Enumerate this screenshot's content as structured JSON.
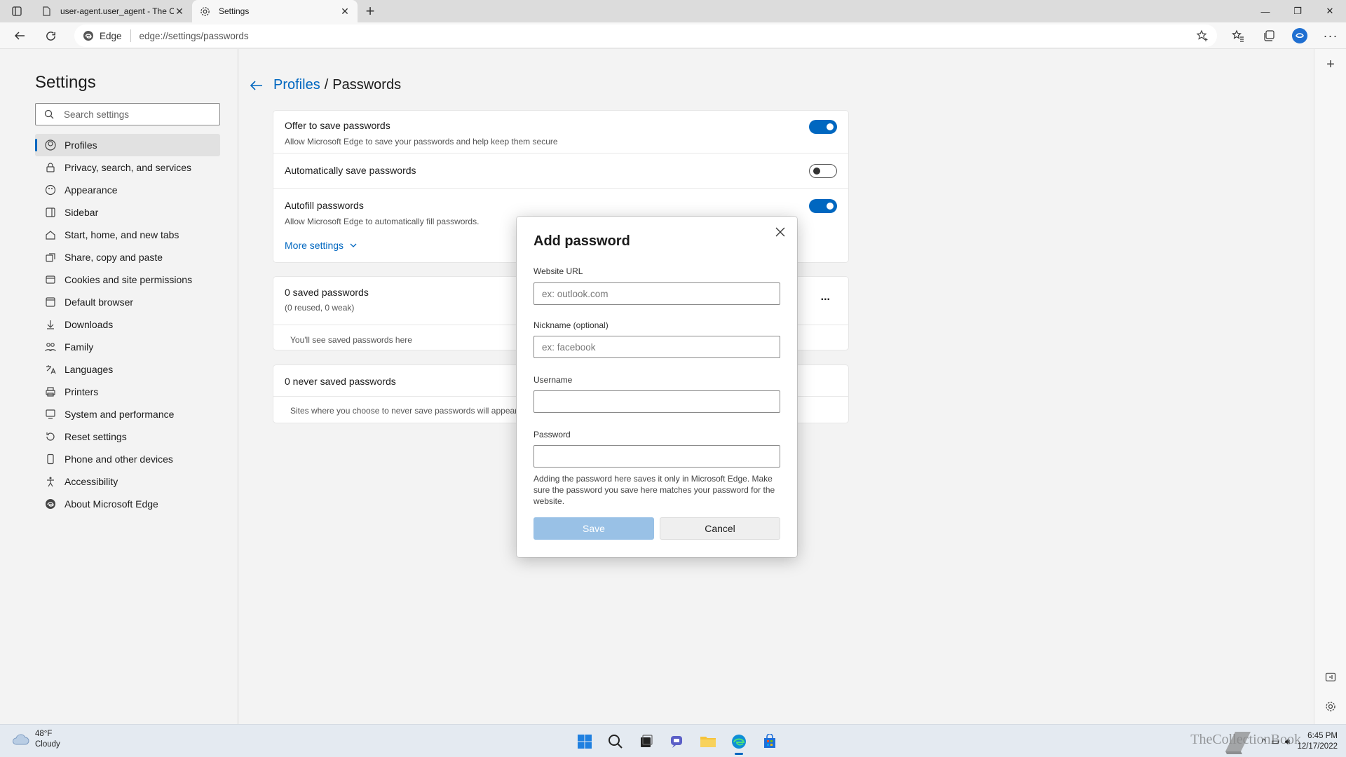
{
  "browser": {
    "tabs": [
      {
        "title": "user-agent.user_agent - The Coll",
        "active": false
      },
      {
        "title": "Settings",
        "active": true
      }
    ],
    "address": {
      "chip": "Edge",
      "url": "edge://settings/passwords"
    }
  },
  "sidebar": {
    "title": "Settings",
    "search_placeholder": "Search settings",
    "items": [
      {
        "label": "Profiles",
        "icon": "profile-icon",
        "selected": true
      },
      {
        "label": "Privacy, search, and services",
        "icon": "lock-icon"
      },
      {
        "label": "Appearance",
        "icon": "appearance-icon"
      },
      {
        "label": "Sidebar",
        "icon": "sidebar-icon"
      },
      {
        "label": "Start, home, and new tabs",
        "icon": "home-icon"
      },
      {
        "label": "Share, copy and paste",
        "icon": "share-icon"
      },
      {
        "label": "Cookies and site permissions",
        "icon": "cookie-icon"
      },
      {
        "label": "Default browser",
        "icon": "browser-icon"
      },
      {
        "label": "Downloads",
        "icon": "download-icon"
      },
      {
        "label": "Family",
        "icon": "family-icon"
      },
      {
        "label": "Languages",
        "icon": "language-icon"
      },
      {
        "label": "Printers",
        "icon": "printer-icon"
      },
      {
        "label": "System and performance",
        "icon": "system-icon"
      },
      {
        "label": "Reset settings",
        "icon": "reset-icon"
      },
      {
        "label": "Phone and other devices",
        "icon": "phone-icon"
      },
      {
        "label": "Accessibility",
        "icon": "accessibility-icon"
      },
      {
        "label": "About Microsoft Edge",
        "icon": "edge-icon"
      }
    ]
  },
  "main": {
    "breadcrumb": {
      "parent": "Profiles",
      "separator": "/",
      "current": "Passwords"
    },
    "settings": {
      "offer_title": "Offer to save passwords",
      "offer_sub": "Allow Microsoft Edge to save your passwords and help keep them secure",
      "offer_on": true,
      "auto_title": "Automatically save passwords",
      "auto_on": false,
      "autofill_title": "Autofill passwords",
      "autofill_sub": "Allow Microsoft Edge to automatically fill passwords.",
      "autofill_on": true,
      "more": "More settings"
    },
    "saved": {
      "title": "0 saved passwords",
      "sub": "(0 reused, 0 weak)",
      "empty": "You'll see saved passwords here",
      "menu": "..."
    },
    "never": {
      "title": "0 never saved passwords",
      "empty": "Sites where you choose to never save passwords will appear here"
    }
  },
  "dialog": {
    "title": "Add password",
    "url_label": "Website URL",
    "url_placeholder": "ex: outlook.com",
    "nickname_label": "Nickname (optional)",
    "nickname_placeholder": "ex: facebook",
    "username_label": "Username",
    "username_value": "",
    "password_label": "Password",
    "password_value": "",
    "note": "Adding the password here saves it only in Microsoft Edge. Make sure the password you save here matches your password for the website.",
    "save": "Save",
    "cancel": "Cancel"
  },
  "taskbar": {
    "weather_temp": "48°F",
    "weather_desc": "Cloudy",
    "time": "6:45 PM",
    "date": "12/17/2022",
    "watermark": "TheCollectionBook"
  },
  "colors": {
    "accent": "#0067c0",
    "save_disabled": "#99c1e6"
  }
}
